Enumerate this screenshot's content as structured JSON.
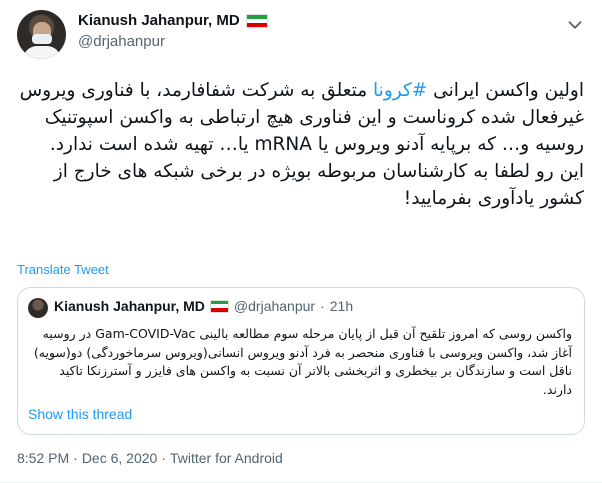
{
  "author": {
    "name": "Kianush Jahanpur, MD",
    "handle": "@drjahanpur",
    "flag_colors": [
      "#239f40",
      "#ffffff",
      "#da0000"
    ]
  },
  "tweet": {
    "text_before_hashtag": "اولین واکسن ایرانی ",
    "hashtag": "#کرونا",
    "text_after_hashtag": " متعلق به شرکت شفافارمد، با فناوری ویروس غیرفعال شده کروناست و این فناوری هیچ ارتباطی به واکسن اسپوتنیک روسیه و… که برپایه آدنو ویروس یا mRNA یا… تهیه شده است ندارد.",
    "text_line2": "این رو لطفا به کارشناسان مربوطه بویژه در برخی شبکه های خارج از کشور یادآوری بفرمایید!"
  },
  "translate_label": "Translate Tweet",
  "quoted": {
    "name": "Kianush Jahanpur, MD",
    "handle": "@drjahanpur",
    "separator": "·",
    "time": "21h",
    "text": "واکسن روسی که امروز تلقیح آن قبل از پایان مرحله سوم مطالعه بالینی Gam-COVID-Vac در روسیه آغاز شد، واکسن ویروسی با فناوری منحصر به فرد آدنو ویروس انسانی(ویروس سرماخوردگی) دو(سویه) ناقل است و سازندگان بر بیخطری و اثربخشی بالاتر آن نسبت به واکسن های فایزر و آسترزنکا تاکید دارند.",
    "show_thread": "Show this thread"
  },
  "meta": {
    "time": "8:52 PM",
    "separator1": "·",
    "date": "Dec 6, 2020",
    "separator2": "·",
    "source": "Twitter for Android"
  },
  "colors": {
    "link": "#1d9bf0",
    "secondary_text": "#536471",
    "border": "#cfd9de"
  }
}
